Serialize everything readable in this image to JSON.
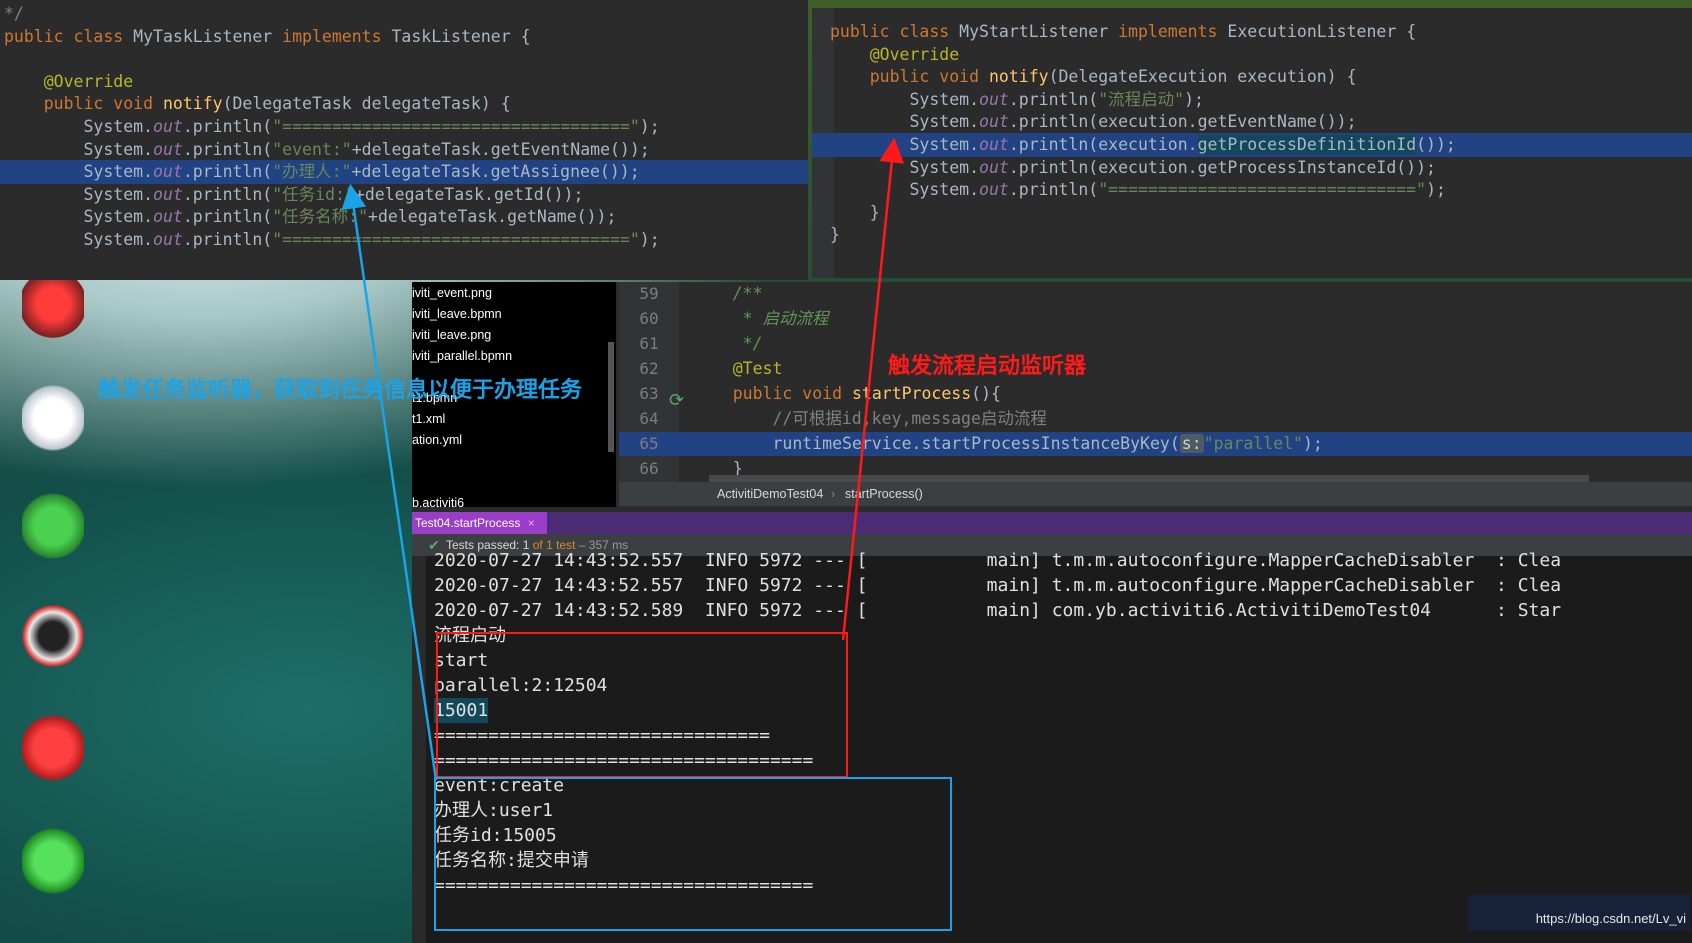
{
  "left_editor": {
    "lines": [
      {
        "segs": [
          [
            "*/",
            "cmt"
          ]
        ]
      },
      {
        "segs": [
          [
            "public ",
            "kw"
          ],
          [
            "class ",
            "kw"
          ],
          [
            "MyTaskListener",
            "cls"
          ],
          [
            " implements ",
            "kw"
          ],
          [
            "TaskListener {",
            "cls"
          ]
        ]
      },
      {
        "segs": [
          [
            "",
            ""
          ]
        ]
      },
      {
        "segs": [
          [
            "    @Override",
            "ann"
          ]
        ]
      },
      {
        "segs": [
          [
            "    public ",
            "kw"
          ],
          [
            "void ",
            "kw"
          ],
          [
            "notify",
            "fn"
          ],
          [
            "(DelegateTask delegateTask) {",
            "cls"
          ]
        ]
      },
      {
        "segs": [
          [
            "        System.",
            "cls"
          ],
          [
            "out",
            "fld"
          ],
          [
            ".println(",
            "cls"
          ],
          [
            "\"===================================\"",
            "str"
          ],
          [
            ");",
            "cls"
          ]
        ]
      },
      {
        "segs": [
          [
            "        System.",
            "cls"
          ],
          [
            "out",
            "fld"
          ],
          [
            ".println(",
            "cls"
          ],
          [
            "\"event:\"",
            "str"
          ],
          [
            "+delegateTask.getEventName());",
            "cls"
          ]
        ]
      },
      {
        "segs": [
          [
            "        System.",
            "cls"
          ],
          [
            "out",
            "fld"
          ],
          [
            ".println(",
            "cls"
          ],
          [
            "\"办理人:\"",
            "str"
          ],
          [
            "+delegateTask.getAssignee());",
            "cls"
          ]
        ],
        "highlight": true
      },
      {
        "segs": [
          [
            "        System.",
            "cls"
          ],
          [
            "out",
            "fld"
          ],
          [
            ".println(",
            "cls"
          ],
          [
            "\"任务id:\"",
            "str"
          ],
          [
            "+delegateTask.getId());",
            "cls"
          ]
        ]
      },
      {
        "segs": [
          [
            "        System.",
            "cls"
          ],
          [
            "out",
            "fld"
          ],
          [
            ".println(",
            "cls"
          ],
          [
            "\"任务名称:\"",
            "str"
          ],
          [
            "+delegateTask.getName());",
            "cls"
          ]
        ]
      },
      {
        "segs": [
          [
            "        System.",
            "cls"
          ],
          [
            "out",
            "fld"
          ],
          [
            ".println(",
            "cls"
          ],
          [
            "\"===================================\"",
            "str"
          ],
          [
            ");",
            "cls"
          ]
        ]
      }
    ]
  },
  "right_editor": {
    "lines": [
      {
        "segs": [
          [
            "public ",
            "kw"
          ],
          [
            "class ",
            "kw"
          ],
          [
            "MyStartListener",
            "cls"
          ],
          [
            " implements ",
            "kw"
          ],
          [
            "ExecutionListener {",
            "cls"
          ]
        ]
      },
      {
        "segs": [
          [
            "    @Override",
            "ann"
          ]
        ]
      },
      {
        "segs": [
          [
            "    public ",
            "kw"
          ],
          [
            "void ",
            "kw"
          ],
          [
            "notify",
            "fn"
          ],
          [
            "(DelegateExecution execution) {",
            "cls"
          ]
        ]
      },
      {
        "segs": [
          [
            "        System.",
            "cls"
          ],
          [
            "out",
            "fld"
          ],
          [
            ".println(",
            "cls"
          ],
          [
            "\"流程启动\"",
            "str"
          ],
          [
            ");",
            "cls"
          ]
        ]
      },
      {
        "segs": [
          [
            "        System.",
            "cls"
          ],
          [
            "out",
            "fld"
          ],
          [
            ".println(execution.getEventName());",
            "cls"
          ]
        ]
      },
      {
        "segs": [
          [
            "        System.",
            "cls"
          ],
          [
            "out",
            "fld"
          ],
          [
            ".println(execution.",
            "cls"
          ],
          [
            "getProcessDefinitionId",
            "sel"
          ],
          [
            "());",
            "cls"
          ]
        ],
        "highlight": true
      },
      {
        "segs": [
          [
            "        System.",
            "cls"
          ],
          [
            "out",
            "fld"
          ],
          [
            ".println(execution.getProcessInstanceId());",
            "cls"
          ]
        ]
      },
      {
        "segs": [
          [
            "        System.",
            "cls"
          ],
          [
            "out",
            "fld"
          ],
          [
            ".println(",
            "cls"
          ],
          [
            "\"===============================\"",
            "str"
          ],
          [
            ");",
            "cls"
          ]
        ]
      },
      {
        "segs": [
          [
            "    }",
            "cls"
          ]
        ]
      },
      {
        "segs": [
          [
            "}",
            "cls"
          ]
        ]
      }
    ]
  },
  "project_tree": {
    "items": [
      "iviti_event.png",
      "iviti_leave.bpmn",
      "iviti_leave.png",
      "iviti_parallel.bpmn",
      "",
      "t1.bpmn",
      "t1.xml",
      "ation.yml",
      "",
      "",
      "b.activiti6"
    ]
  },
  "test_editor": {
    "lines": [
      {
        "num": "59",
        "segs": [
          [
            "    /**",
            "doc"
          ]
        ]
      },
      {
        "num": "60",
        "segs": [
          [
            "     * 启动流程",
            "doc"
          ]
        ]
      },
      {
        "num": "61",
        "segs": [
          [
            "     */",
            "doc"
          ]
        ]
      },
      {
        "num": "62",
        "segs": [
          [
            "    @Test",
            "ann"
          ]
        ]
      },
      {
        "num": "63",
        "segs": [
          [
            "    public ",
            "kw"
          ],
          [
            "void ",
            "kw"
          ],
          [
            "startProcess",
            "fn"
          ],
          [
            "(){",
            "cls"
          ]
        ]
      },
      {
        "num": "64",
        "segs": [
          [
            "        //可根据id,key,message启动流程",
            "cmt"
          ]
        ]
      },
      {
        "num": "65",
        "segs": [
          [
            "        runtimeService.startProcessInstanceByKey(",
            "cls"
          ],
          [
            "s:",
            "hint"
          ],
          [
            "\"parallel\"",
            "str"
          ],
          [
            ");",
            "cls"
          ]
        ],
        "highlight": true
      },
      {
        "num": "66",
        "segs": [
          [
            "    }",
            "cls"
          ]
        ]
      }
    ],
    "breadcrumb": [
      "ActivitiDemoTest04",
      "startProcess()"
    ]
  },
  "run_tab": {
    "label": "Test04.startProcess",
    "close": "×"
  },
  "test_status": {
    "prefix": "Tests passed: ",
    "passed": "1",
    "of": " of 1 test",
    "time": " – 357 ms"
  },
  "console": {
    "lines": [
      "2020-07-27 14:43:52.557  INFO 5972 --- [           main] t.m.m.autoconfigure.MapperCacheDisabler  : Clea",
      "2020-07-27 14:43:52.557  INFO 5972 --- [           main] t.m.m.autoconfigure.MapperCacheDisabler  : Clea",
      "2020-07-27 14:43:52.589  INFO 5972 --- [           main] com.yb.activiti6.ActivitiDemoTest04      : Star",
      "流程启动",
      "start",
      "parallel:2:12504",
      "15001",
      "===============================",
      "===================================",
      "event:create",
      "办理人:user1",
      "任务id:15005",
      "任务名称:提交申请",
      "==================================="
    ]
  },
  "annotations": {
    "blue_label": "触发任务监听器，获取到任务信息以便于办理任务",
    "red_label": "触发流程启动监听器",
    "blue_color": "#1aa3e8",
    "red_color": "#ff1a1a"
  },
  "watermark": "https://blog.csdn.net/Lv_vi"
}
